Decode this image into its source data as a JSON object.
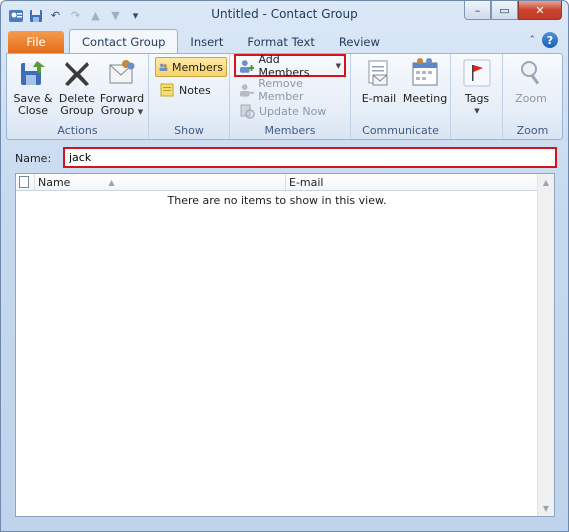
{
  "window": {
    "title": "Untitled  -  Contact Group",
    "controls": {
      "minimize": "–",
      "restore": "▭",
      "close": "✕"
    }
  },
  "quick_access": {
    "app_icon": "outlook-contacts-icon",
    "save": "save-icon",
    "undo": "undo-icon",
    "redo": "redo-icon",
    "up": "arrow-up-icon",
    "down": "arrow-down-icon",
    "customize": "▾"
  },
  "tabs": [
    "File",
    "Contact Group",
    "Insert",
    "Format Text",
    "Review"
  ],
  "ribbon": {
    "actions": {
      "label": "Actions",
      "save_close_line1": "Save &",
      "save_close_line2": "Close",
      "delete_group_line1": "Delete",
      "delete_group_line2": "Group",
      "forward_group_line1": "Forward",
      "forward_group_line2": "Group"
    },
    "show": {
      "label": "Show",
      "members": "Members",
      "notes": "Notes"
    },
    "members": {
      "label": "Members",
      "add_members": "Add Members",
      "remove_member": "Remove Member",
      "update_now": "Update Now"
    },
    "communicate": {
      "label": "Communicate",
      "email": "E-mail",
      "meeting": "Meeting"
    },
    "tags": {
      "label": "Tags"
    },
    "zoom": {
      "label": "Zoom",
      "zoom": "Zoom"
    }
  },
  "form": {
    "name_label": "Name:",
    "name_value": "jack"
  },
  "list": {
    "columns": [
      "Name",
      "E-mail"
    ],
    "empty_message": "There are no items to show in this view."
  },
  "colors": {
    "file_tab": "#e26d1a",
    "highlight": "#d4141b",
    "selected": "#f8d46a"
  }
}
